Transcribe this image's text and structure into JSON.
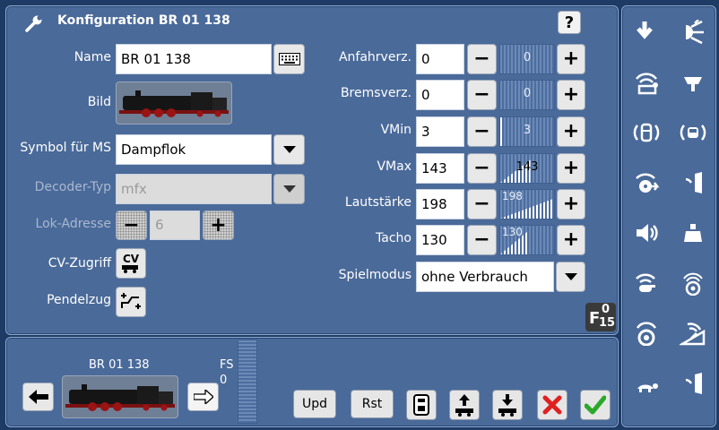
{
  "header": {
    "title": "Konfiguration BR 01 138",
    "help_label": "?"
  },
  "form": {
    "name_label": "Name",
    "name_value": "BR 01 138",
    "bild_label": "Bild",
    "symbol_label": "Symbol für MS",
    "symbol_value": "Dampflok",
    "decoder_label": "Decoder-Typ",
    "decoder_value": "mfx",
    "adresse_label": "Lok-Adresse",
    "adresse_value": "6",
    "cv_label": "CV-Zugriff",
    "cv_button": "CV",
    "pendel_label": "Pendelzug"
  },
  "params": [
    {
      "label": "Anfahrverz.",
      "value": "0",
      "slider": "0",
      "level": 0
    },
    {
      "label": "Bremsverz.",
      "value": "0",
      "slider": "0",
      "level": 0
    },
    {
      "label": "VMin",
      "value": "3",
      "slider": "3",
      "level": 0.01
    },
    {
      "label": "VMax",
      "value": "143",
      "slider": "143",
      "level": 0.56
    },
    {
      "label": "Lautstärke",
      "value": "198",
      "slider": "198",
      "level": 0.78
    },
    {
      "label": "Tacho",
      "value": "130",
      "slider": "130",
      "level": 0.51
    }
  ],
  "spielmodus": {
    "label": "Spielmodus",
    "value": "ohne Verbrauch"
  },
  "function_badge": {
    "letter": "F",
    "top": "0",
    "bottom": "15"
  },
  "bottom": {
    "loco_name": "BR 01 138",
    "fs_label": "FS",
    "fs_value": "0",
    "upd_label": "Upd",
    "rst_label": "Rst"
  },
  "sidebar_icons": [
    "arrow-down-icon",
    "light-icon",
    "wifi-horn-icon",
    "ceiling-lamp-icon",
    "cabin-sound-icon",
    "bus-sound-icon",
    "wifi-fan-icon",
    "door-icon",
    "speaker-icon",
    "weight-icon",
    "whistle-icon",
    "wheel-sound-icon",
    "wheel-wifi-icon",
    "coupler-ramp-icon",
    "turtle-icon",
    "door-right-icon"
  ],
  "colors": {
    "background": "#1e3b66",
    "panel": "#4a6a99",
    "cancel": "#e02020",
    "confirm": "#2aa82a"
  }
}
